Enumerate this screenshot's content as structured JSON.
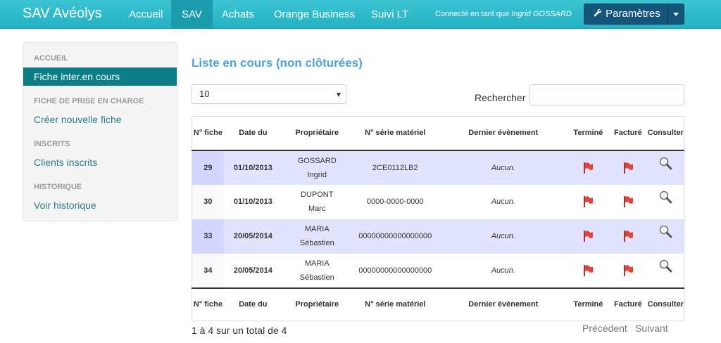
{
  "navbar": {
    "brand": "SAV Avéolys",
    "items": [
      {
        "label": "Accueil",
        "active": false
      },
      {
        "label": "SAV",
        "active": true
      },
      {
        "label": "Achats",
        "active": false
      },
      {
        "label": "Orange Business",
        "active": false
      },
      {
        "label": "Suivi LT",
        "active": false
      }
    ],
    "connected_prefix": "Connecté en tant que",
    "connected_user": "Ingrid GOSSARD",
    "settings_label": "Paramètres",
    "settings_icon": "wrench-icon"
  },
  "sidebar": {
    "sections": [
      {
        "header": "Accueil",
        "item": "Fiche inter.en cours",
        "active": true
      },
      {
        "header": "Fiche de prise en charge",
        "item": "Créer nouvelle fiche",
        "active": false
      },
      {
        "header": "Inscrits",
        "item": "Clients inscrits",
        "active": false
      },
      {
        "header": "Historique",
        "item": "Voir historique",
        "active": false
      }
    ]
  },
  "main": {
    "title": "Liste en cours (non clôturées)",
    "page_size": "10",
    "search_label": "Rechercher",
    "search_value": ""
  },
  "table": {
    "columns": [
      "N° fiche",
      "Date du",
      "Propriétaire",
      "N° série matériel",
      "Dernier évènement",
      "Terminé",
      "Facturé",
      "Consulter"
    ],
    "rows": [
      {
        "num": "29",
        "date": "01/10/2013",
        "owner_last": "GOSSARD",
        "owner_first": "Ingrid",
        "serial": "2CE0112LB2",
        "event": "Aucun."
      },
      {
        "num": "30",
        "date": "01/10/2013",
        "owner_last": "DUPONT",
        "owner_first": "Marc",
        "serial": "0000-0000-0000",
        "event": "Aucun."
      },
      {
        "num": "33",
        "date": "20/05/2014",
        "owner_last": "MARIA",
        "owner_first": "Sébastien",
        "serial": "00000000000000000",
        "event": "Aucun."
      },
      {
        "num": "34",
        "date": "20/05/2014",
        "owner_last": "MARIA",
        "owner_first": "Sébastien",
        "serial": "00000000000000000",
        "event": "Aucun."
      }
    ],
    "flag_color": "#e0453a",
    "flag_icon": "red-flag-icon",
    "consult_icon": "magnifier-icon"
  },
  "footer": {
    "info": "1 à 4 sur un total de 4",
    "prev": "Précédent",
    "next": "Suivant"
  }
}
